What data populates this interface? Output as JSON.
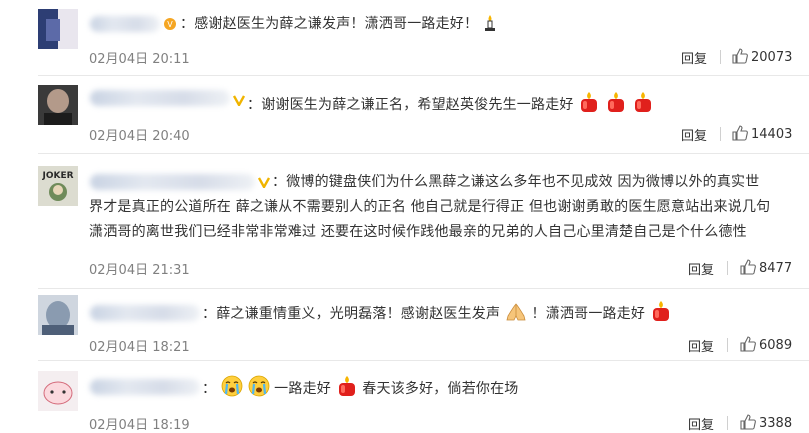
{
  "comments": [
    {
      "text_parts": [
        "感谢赵医生为薛之谦发声！潇洒哥一路走好！"
      ],
      "time": "02月04日 20:11",
      "reply_label": "回复",
      "likes": "20073"
    },
    {
      "text_parts": [
        "谢谢医生为薛之谦正名，希望赵英俊先生一路走好"
      ],
      "time": "02月04日 20:40",
      "reply_label": "回复",
      "likes": "14403"
    },
    {
      "lines": [
        "微博的键盘侠们为什么黑薛之谦这么多年也不见成效 因为微博以外的真实世",
        "界才是真正的公道所在 薛之谦从不需要别人的正名 他自己就是行得正 但也谢谢勇敢的医生愿意站出来说几句",
        "潇洒哥的离世我们已经非常非常难过 还要在这时候作践他最亲的兄弟的人自己心里清楚自己是个什么德性"
      ],
      "time": "02月04日 21:31",
      "reply_label": "回复",
      "likes": "8477"
    },
    {
      "text_parts": [
        "薛之谦重情重义，光明磊落！感谢赵医生发声",
        "！潇洒哥一路走好"
      ],
      "time": "02月04日 18:21",
      "reply_label": "回复",
      "likes": "6089"
    },
    {
      "text_parts": [
        "一路走好",
        "春天该多好，倘若你在场"
      ],
      "time": "02月04日 18:19",
      "reply_label": "回复",
      "likes": "3388"
    }
  ],
  "colors": {
    "text": "#333333",
    "time": "#808080",
    "divider": "#e8e8e8",
    "candle_red": "#e0201c",
    "candle_flame": "#f7b500"
  },
  "icons": [
    "candle-icon",
    "prayer-candle-icon",
    "crying-face-icon",
    "praying-hands-icon",
    "thumbs-up-icon",
    "vip-badge-icon"
  ],
  "avatar3_label": "JOKER"
}
